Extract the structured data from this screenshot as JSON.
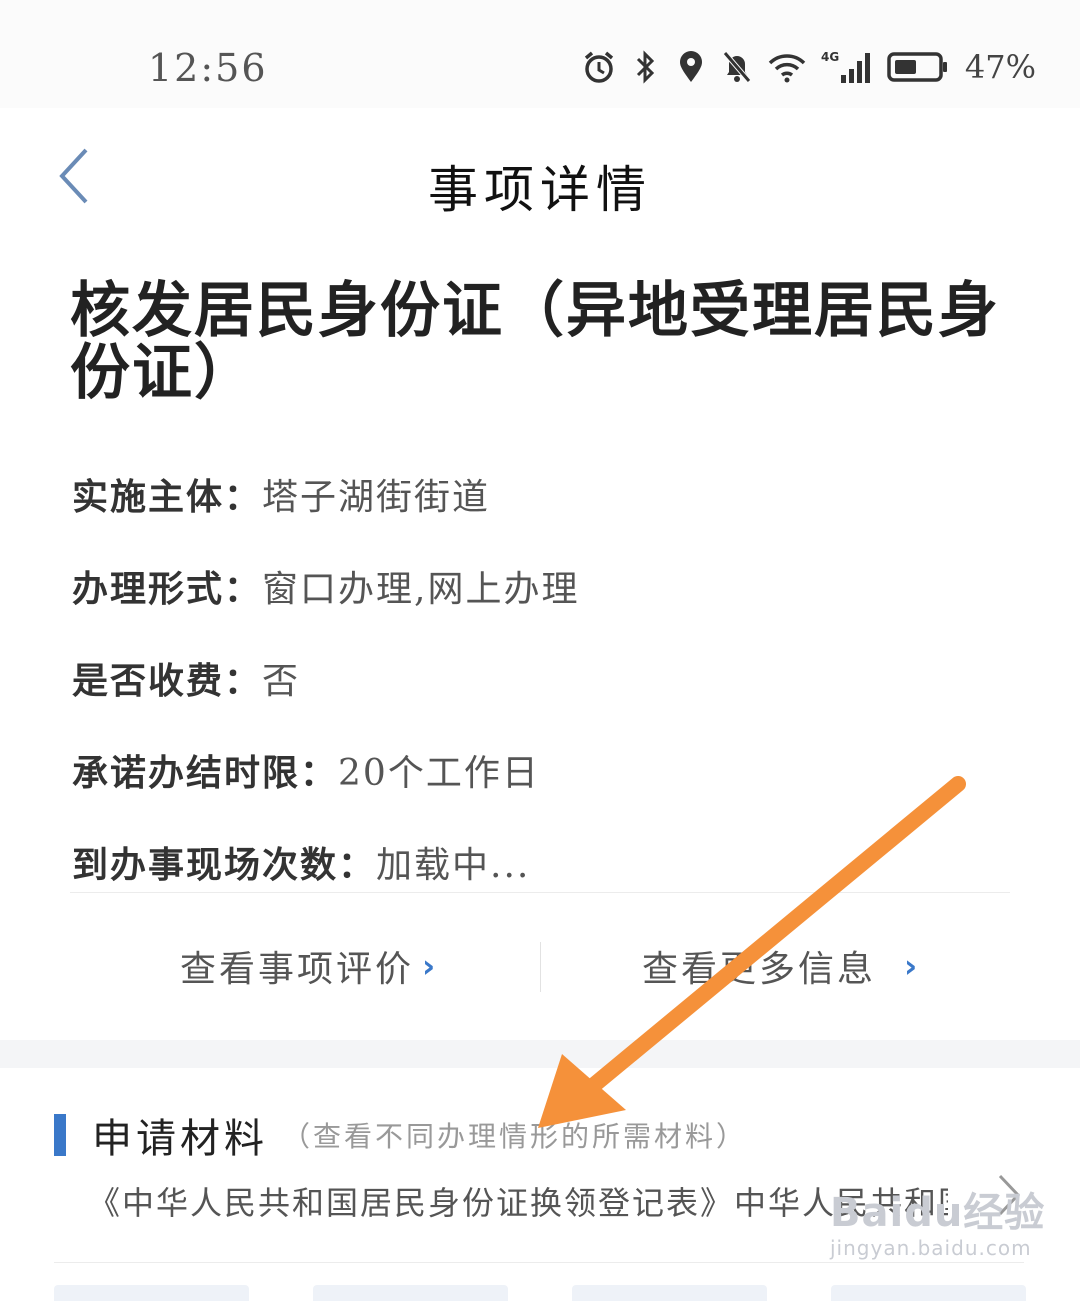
{
  "status_bar": {
    "time": "12:56",
    "icons": [
      "alarm-icon",
      "bluetooth-icon",
      "location-icon",
      "mute-icon",
      "wifi-icon",
      "signal-4g-icon",
      "battery-icon"
    ],
    "network": "4G",
    "battery_percent": "47%"
  },
  "nav": {
    "title": "事项详情",
    "back_icon": "chevron-left-icon"
  },
  "item": {
    "title": "核发居民身份证（异地受理居民身份证）"
  },
  "info": [
    {
      "label": "实施主体：",
      "value": "塔子湖街街道"
    },
    {
      "label": "办理形式：",
      "value": "窗口办理,网上办理"
    },
    {
      "label": "是否收费：",
      "value": "否"
    },
    {
      "label": "承诺办结时限：",
      "value": "20个工作日"
    },
    {
      "label": "到办事现场次数：",
      "value": "加载中..."
    }
  ],
  "links": {
    "evaluation": "查看事项评价",
    "more_info": "查看更多信息",
    "chevron": "›"
  },
  "materials": {
    "title": "申请材料",
    "subtitle": "（查看不同办理情形的所需材料）",
    "first_item": "《中华人民共和国居民身份证换领登记表》中华人民共和国居民身份证换领登记表"
  },
  "colors": {
    "accent": "#3a78c9",
    "annotation_arrow": "#f5913a"
  },
  "watermark": {
    "logo": "Baidu经验",
    "url": "jingyan.baidu.com"
  }
}
